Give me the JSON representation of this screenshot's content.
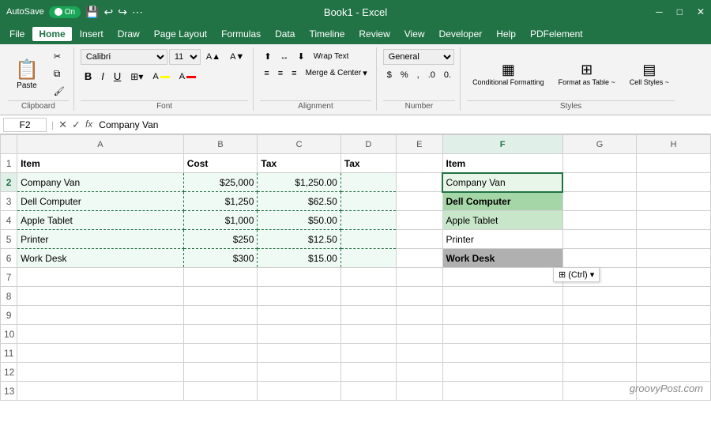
{
  "titlebar": {
    "autosave_label": "AutoSave",
    "autosave_state": "On",
    "title": "Book1 - Excel",
    "icons": [
      "save",
      "undo",
      "redo"
    ]
  },
  "menubar": {
    "items": [
      "File",
      "Home",
      "Insert",
      "Draw",
      "Page Layout",
      "Formulas",
      "Data",
      "Timeline",
      "Review",
      "View",
      "Developer",
      "Help",
      "PDFelement"
    ],
    "active": "Home"
  },
  "ribbon": {
    "clipboard_label": "Clipboard",
    "font_label": "Font",
    "alignment_label": "Alignment",
    "number_label": "Number",
    "styles_label": "Styles",
    "paste_label": "Paste",
    "font_name": "Calibri",
    "font_size": "11",
    "bold": "B",
    "italic": "I",
    "underline": "U",
    "wrap_text": "Wrap Text",
    "merge_center": "Merge & Center",
    "number_format": "General",
    "conditional_formatting": "Conditional Formatting",
    "format_as_table": "Format as Table",
    "cell_styles": "Cell Styles",
    "cell_styles_short": "Cell Styles ~",
    "format_as_table_short": "Format as Table ~"
  },
  "formula_bar": {
    "cell_ref": "F2",
    "formula": "Company Van"
  },
  "sheet": {
    "columns": [
      "A",
      "B",
      "C",
      "D",
      "E",
      "F",
      "G",
      "H"
    ],
    "rows": [
      {
        "num": 1,
        "cells": [
          "Item",
          "Cost",
          "Tax",
          "Tax",
          "",
          "Item",
          "",
          ""
        ]
      },
      {
        "num": 2,
        "cells": [
          "Company Van",
          "$25,000",
          "$1,250.00",
          "",
          "",
          "Company Van",
          "",
          ""
        ]
      },
      {
        "num": 3,
        "cells": [
          "Dell Computer",
          "$1,250",
          "$62.50",
          "",
          "",
          "Dell Computer",
          "",
          ""
        ]
      },
      {
        "num": 4,
        "cells": [
          "Apple Tablet",
          "$1,000",
          "$50.00",
          "",
          "",
          "Apple Tablet",
          "",
          ""
        ]
      },
      {
        "num": 5,
        "cells": [
          "Printer",
          "$250",
          "$12.50",
          "",
          "",
          "Printer",
          "",
          ""
        ]
      },
      {
        "num": 6,
        "cells": [
          "Work Desk",
          "$300",
          "$15.00",
          "",
          "",
          "Work Desk",
          "",
          ""
        ]
      },
      {
        "num": 7,
        "cells": [
          "",
          "",
          "",
          "",
          "",
          "",
          "",
          ""
        ]
      },
      {
        "num": 8,
        "cells": [
          "",
          "",
          "",
          "",
          "",
          "",
          "",
          ""
        ]
      },
      {
        "num": 9,
        "cells": [
          "",
          "",
          "",
          "",
          "",
          "",
          "",
          ""
        ]
      },
      {
        "num": 10,
        "cells": [
          "",
          "",
          "",
          "",
          "",
          "",
          "",
          ""
        ]
      },
      {
        "num": 11,
        "cells": [
          "",
          "",
          "",
          "",
          "",
          "",
          "",
          ""
        ]
      },
      {
        "num": 12,
        "cells": [
          "",
          "",
          "",
          "",
          "",
          "",
          "",
          ""
        ]
      },
      {
        "num": 13,
        "cells": [
          "",
          "",
          "",
          "",
          "",
          "",
          "",
          ""
        ]
      }
    ]
  },
  "watermark": "groovyPost.com",
  "paste_options_text": "⊞ (Ctrl) ▾"
}
